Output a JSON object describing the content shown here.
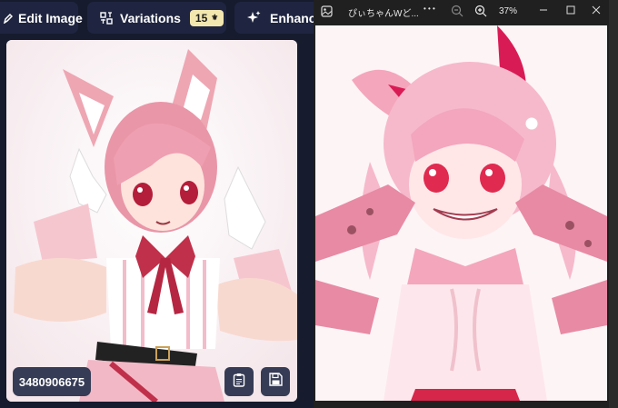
{
  "toolbar": {
    "edit_label": "Edit Image",
    "variations_label": "Variations",
    "variations_count": "15",
    "enhance_label": "Enhance"
  },
  "card": {
    "seed": "3480906675"
  },
  "viewer": {
    "title": "ぴぃちゃんWど...",
    "more": "• • •",
    "zoom": "37%"
  },
  "colors": {
    "app_bg": "#161b2e",
    "button_bg": "#1f2540",
    "credit_badge": "#f3e7b0",
    "viewer_bg": "#202020"
  }
}
